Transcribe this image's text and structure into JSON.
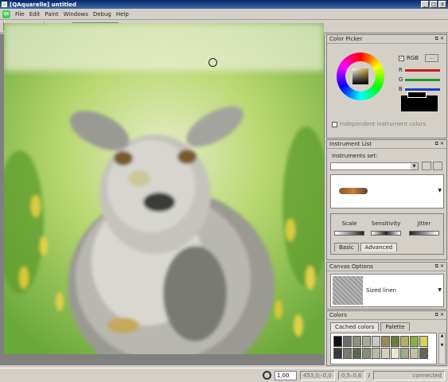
{
  "window": {
    "title": "[QAquarelle] untitled",
    "controls": [
      "_",
      "□",
      "x"
    ]
  },
  "menu": {
    "logo": "Qt",
    "items": [
      "File",
      "Edit",
      "Paint",
      "Windows",
      "Debug",
      "Help"
    ]
  },
  "toolbar": {
    "zoom_value": "Ol"
  },
  "status": {
    "zoom": "1,00",
    "coords": "453,0;-0,0",
    "range": "0,5–0,6",
    "connection": "connected"
  },
  "color_picker": {
    "title": "Color Picker",
    "rgb_label": "RGB",
    "more_label": "...",
    "channels": [
      {
        "label": "R",
        "color": "#c81e1e"
      },
      {
        "label": "G",
        "color": "#1e9a2e"
      },
      {
        "label": "B",
        "color": "#1e3ec8"
      }
    ],
    "independent_label": "Independent instrument colors"
  },
  "instrument_list": {
    "title": "Instrument List",
    "set_label": "Instruments set:",
    "params": [
      "Scale",
      "Sensitivity",
      "Jitter"
    ],
    "tabs": [
      "Basic",
      "Advanced"
    ]
  },
  "canvas_options": {
    "title": "Canvas Options",
    "canvas_name": "Sized linen"
  },
  "colors": {
    "title": "Colors",
    "tabs": [
      "Cached colors",
      "Palette"
    ],
    "swatches": [
      "#111111",
      "#6b6b6b",
      "#8e8e7e",
      "#a8a89a",
      "#c8c8be",
      "#9a8a5a",
      "#6a7a3a",
      "#b0b060",
      "#88b040",
      "#d8d060",
      "#3a3a3a",
      "#7a7a6a",
      "#5a6a4a",
      "#8a8a7a",
      "#b8b8a8",
      "#d0d0c0",
      "#e8e8c8",
      "#a0a888",
      "#c8c0a0",
      "#606858"
    ]
  }
}
